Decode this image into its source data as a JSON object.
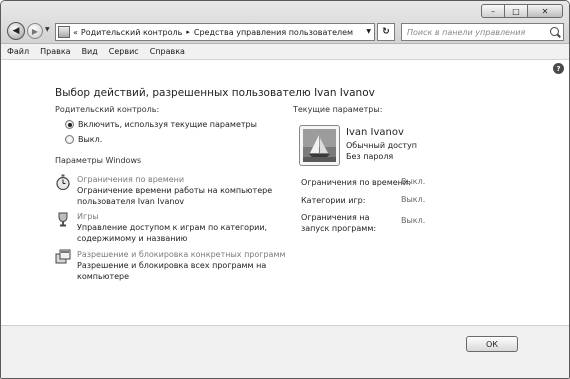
{
  "window": {
    "caption_min": "–",
    "caption_max": "□",
    "caption_close": "✕"
  },
  "address_bar": {
    "prefix_chevron": "«",
    "segments": [
      "Родительский контроль",
      "Средства управления пользователем"
    ],
    "separator": "▸",
    "refresh_glyph": "↻"
  },
  "search": {
    "placeholder": "Поиск в панели управления"
  },
  "menu": [
    "Файл",
    "Правка",
    "Вид",
    "Сервис",
    "Справка"
  ],
  "page_title": "Выбор действий, разрешенных пользователю Ivan Ivanov",
  "parental_control": {
    "label": "Родительский контроль:",
    "options": [
      {
        "label": "Включить, используя текущие параметры",
        "checked": true
      },
      {
        "label": "Выкл.",
        "checked": false
      }
    ]
  },
  "windows_params": {
    "label": "Параметры Windows",
    "items": [
      {
        "link": "Ограничения по времени",
        "desc_line1": "Ограничение времени работы на компьютере",
        "desc_line2": "пользователя Ivan Ivanov",
        "icon": "stopwatch-icon"
      },
      {
        "link": "Игры",
        "desc_line1": "Управление доступом к играм по категории,",
        "desc_line2": "содержимому и названию",
        "icon": "trophy-icon"
      },
      {
        "link": "Разрешение и блокировка конкретных программ",
        "desc_line1": "Разрешение и блокировка всех программ на",
        "desc_line2": "компьютере",
        "icon": "programs-icon"
      }
    ]
  },
  "current_params": {
    "label": "Текущие параметры:",
    "user_name": "Ivan Ivanov",
    "user_type": "Обычный доступ",
    "password_status": "Без пароля",
    "rows": [
      {
        "key": "Ограничения по времени:",
        "value": "Выкл."
      },
      {
        "key": "Категории игр:",
        "value": "Выкл."
      },
      {
        "key_line1": "Ограничения на",
        "key_line2": "запуск программ:",
        "value": "Выкл."
      }
    ]
  },
  "buttons": {
    "ok": "ОК"
  },
  "help": {
    "glyph": "?"
  }
}
